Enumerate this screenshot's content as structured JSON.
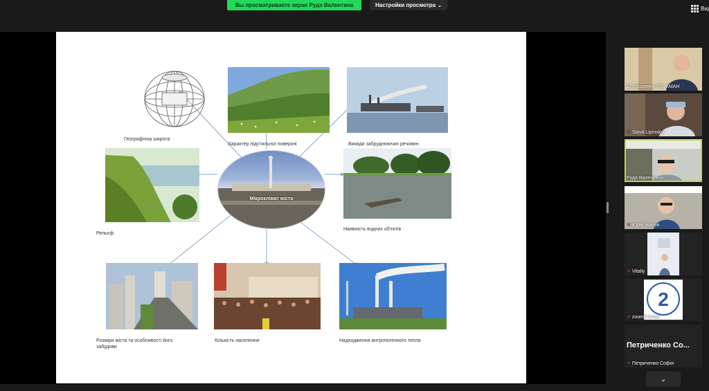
{
  "toolbar": {
    "share_status": "Вы просматриваете экран Руда Валентина",
    "view_options_label": "Настройки просмотра",
    "view_toggle_label": "Вид"
  },
  "slide": {
    "center_label": "Мікроклімат міста",
    "items": [
      {
        "id": "latitude",
        "caption": "Географічна широта",
        "icon": "globe-icon"
      },
      {
        "id": "surface",
        "caption": "Характер підстильної поверхні"
      },
      {
        "id": "emissions",
        "caption": "Викиди забруднюючих речовин"
      },
      {
        "id": "relief",
        "caption": "Рельєф"
      },
      {
        "id": "water",
        "caption": "Наявність водних об'єктів"
      },
      {
        "id": "size",
        "caption": "Розміри міста та особливості його забудови"
      },
      {
        "id": "population",
        "caption": "Кількість населення"
      },
      {
        "id": "heat",
        "caption": "Надходження антропогенного тепла"
      }
    ]
  },
  "participants": [
    {
      "name": "Слободянюк Т.В. КМАН",
      "muted": false,
      "active": false
    },
    {
      "name": "Slava Lipinskyi",
      "muted": true,
      "active": false
    },
    {
      "name": "Руда Валентина",
      "muted": false,
      "active": true
    },
    {
      "name": "Юрій Іванов",
      "muted": true,
      "active": false
    },
    {
      "name": "Vitaliy",
      "muted": true,
      "active": false
    },
    {
      "name": "zoom2 kman",
      "muted": true,
      "active": false,
      "logo_text": "2"
    },
    {
      "name": "Петриченко Софія",
      "muted": true,
      "active": false,
      "display_text": "Петриченко Со..."
    }
  ],
  "colors": {
    "share_banner": "#23d959",
    "active_speaker": "#c3d84a",
    "muted_icon": "#e0394a",
    "arrow": "#8aa7cf"
  },
  "icons": {
    "view": "grid-icon",
    "view_options": "chevron-down-icon",
    "scroll": "chevron-down-icon",
    "mute": "muted-microphone-icon"
  }
}
